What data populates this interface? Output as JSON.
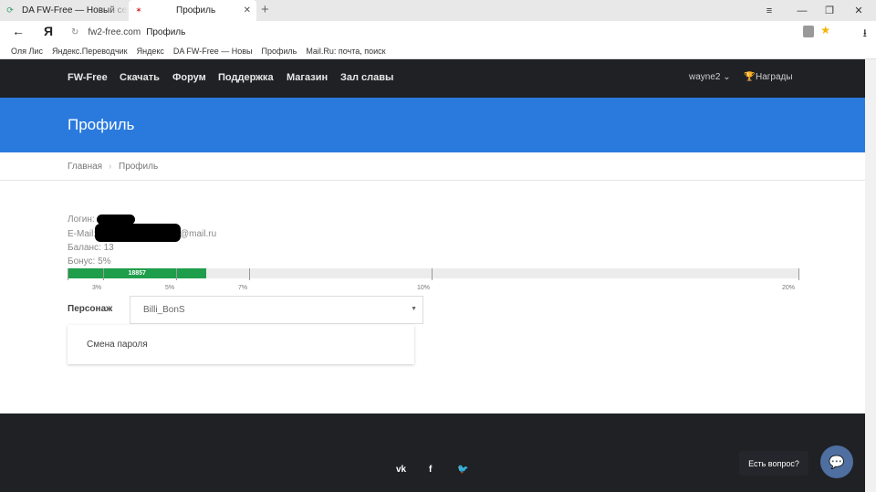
{
  "browser": {
    "tabs": [
      {
        "label": "DA FW-Free — Новый серв",
        "icon": "refresh-favicon-icon"
      },
      {
        "label": "Профиль",
        "icon": "site-favicon-icon"
      }
    ],
    "new_tab": "+",
    "url_host": "fw2-free.com",
    "url_title": "Профиль",
    "bookmarks": [
      "Оля Лис",
      "Яндекс.Переводчик",
      "Яндекс",
      "DA FW-Free — Новы",
      "Профиль",
      "Mail.Ru: почта, поиск"
    ]
  },
  "nav": {
    "brand": "FW-Free",
    "items": [
      "Скачать",
      "Форум",
      "Поддержка",
      "Магазин",
      "Зал славы"
    ],
    "user": "wayne2 ⌄",
    "awards": "Награды"
  },
  "hero": {
    "title": "Профиль"
  },
  "breadcrumb": {
    "home": "Главная",
    "sep": "›",
    "current": "Профиль"
  },
  "profile": {
    "login_label": "Логин:",
    "email_label": "E-Mail:",
    "email_suffix": "@mail.ru",
    "balance": "Баланс: 13",
    "bonus": "Бонус: 5%"
  },
  "progress": {
    "value_label": "18857",
    "fill_fraction": 0.19,
    "ticks": [
      {
        "label": "3%"
      },
      {
        "label": "5%"
      },
      {
        "label": "7%"
      },
      {
        "label": "10%"
      },
      {
        "label": "20%"
      }
    ]
  },
  "character": {
    "label": "Персонаж",
    "selected": "Billi_BonS"
  },
  "menu": {
    "change_password": "Смена пароля"
  },
  "footer": {
    "social": [
      "vk",
      "f",
      "twitter"
    ]
  },
  "chat": {
    "prompt": "Есть вопрос?"
  }
}
